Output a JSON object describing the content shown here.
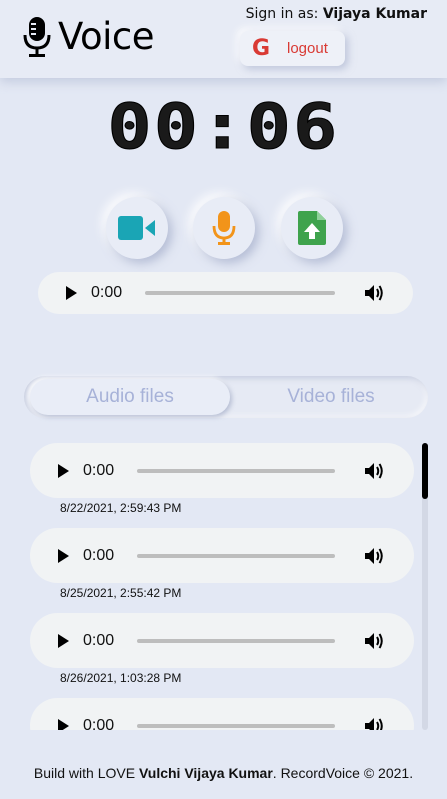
{
  "header": {
    "brand": "Voice",
    "signin_prefix": "Sign in as:",
    "user_name": "Vijaya Kumar",
    "logout_icon_letter": "G",
    "logout_label": "logout"
  },
  "recorder": {
    "timer": "00:06",
    "video_icon": "video-camera-icon",
    "mic_icon": "microphone-icon",
    "upload_icon": "file-upload-icon",
    "colors": {
      "video": "#1aa5b5",
      "mic": "#f2941a",
      "upload": "#3fa34d"
    }
  },
  "main_player": {
    "time": "0:00"
  },
  "tabs": [
    {
      "label": "Audio files",
      "active": true
    },
    {
      "label": "Video files",
      "active": false
    }
  ],
  "recordings": [
    {
      "time": "0:00",
      "date": "8/22/2021, 2:59:43 PM"
    },
    {
      "time": "0:00",
      "date": "8/25/2021, 2:55:42 PM"
    },
    {
      "time": "0:00",
      "date": "8/26/2021, 1:03:28 PM"
    },
    {
      "time": "0:00",
      "date": ""
    }
  ],
  "footer": {
    "prefix": "Build with LOVE",
    "author": "Vulchi Vijaya Kumar",
    "suffix": ". RecordVoice © 2021."
  }
}
